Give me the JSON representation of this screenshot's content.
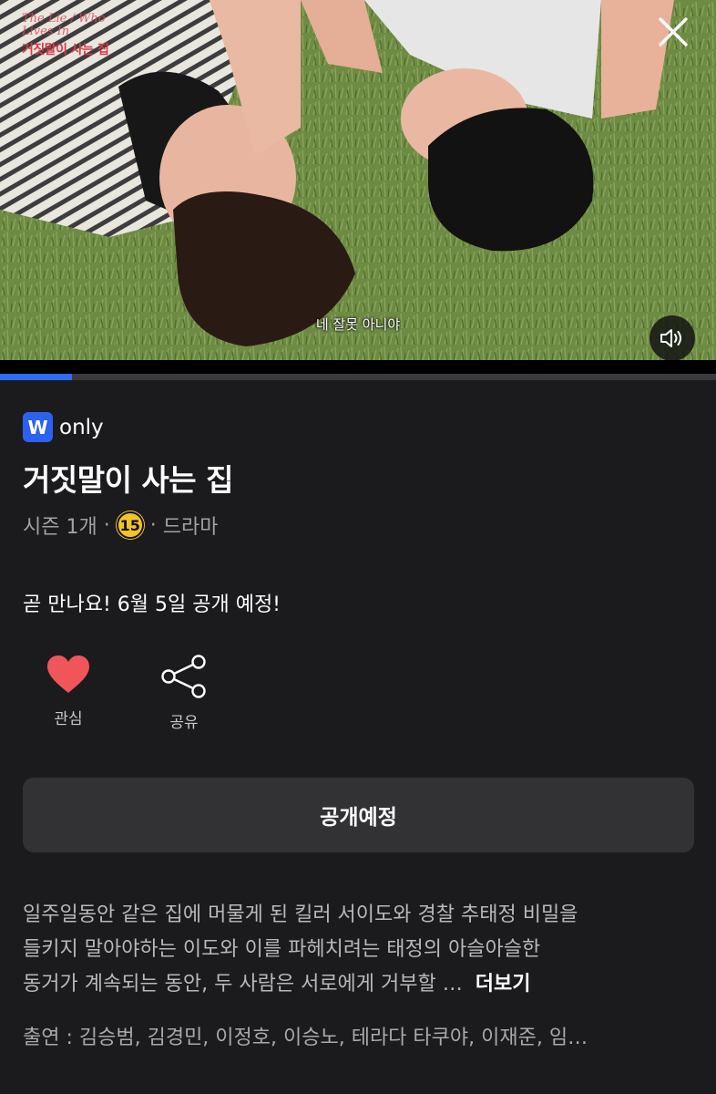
{
  "video": {
    "logo_script": "The Lie / Who Lives In",
    "logo_korean": "거짓말이 사는 집",
    "subtitle": "네 잘못 아니야",
    "progress": 0.1,
    "close_icon": "close-icon",
    "sound_icon": "speaker-icon"
  },
  "badge": {
    "letter": "W",
    "label": "only"
  },
  "title": "거짓말이 사는 집",
  "meta": {
    "seasons": "시즌 1개",
    "age_rating": "15",
    "genre": "드라마",
    "separator": "·"
  },
  "notice": "곧 만나요! 6월 5일 공개 예정!",
  "actions": [
    {
      "label": "관심",
      "icon": "heart-icon",
      "color": "#f0555a"
    },
    {
      "label": "공유",
      "icon": "share-icon"
    }
  ],
  "cta_label": "공개예정",
  "description": {
    "line1": "일주일동안 같은 집에 머물게 된 킬러 서이도와 경찰 추태정 비밀을",
    "line2": "들키지 말아야하는 이도와 이를 파헤치려는 태정의 아슬아슬한",
    "line3": "동거가 계속되는 동안, 두 사람은 서로에게 거부할 …",
    "more_label": "더보기"
  },
  "cast": "출연 : 김승범, 김경민, 이정호, 이승노, 테라다 타쿠야, 이재준, 임…",
  "colors": {
    "background": "#1b1b1d",
    "accent": "#2f6cf6",
    "age_badge": "#f2c42b"
  }
}
